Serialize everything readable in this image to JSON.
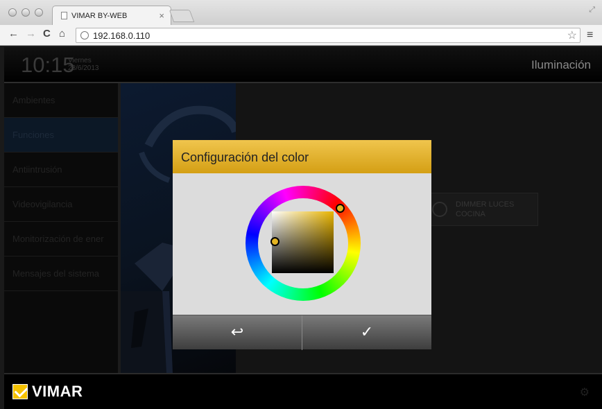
{
  "browser": {
    "tab_title": "VIMAR BY-WEB",
    "tab_close": "×",
    "url": "192.168.0.110",
    "back": "←",
    "forward": "→",
    "reload": "C",
    "home": "⌂",
    "star": "☆",
    "menu": "≡"
  },
  "header": {
    "time": "10:15",
    "day": "Viernes",
    "date": "28/6/2013",
    "section": "Iluminación"
  },
  "sidebar": {
    "items": [
      {
        "label": "Ambientes"
      },
      {
        "label": "Funciones"
      },
      {
        "label": "Antiintrusión"
      },
      {
        "label": "Videovigilancia"
      },
      {
        "label": "Monitorización de ener"
      },
      {
        "label": "Mensajes del sistema"
      }
    ],
    "active_index": 1
  },
  "content": {
    "dimmer_label": "DIMMER LUCES COCINA"
  },
  "footer": {
    "brand": "VIMAR"
  },
  "modal": {
    "title": "Configuración del color",
    "back_glyph": "↩",
    "confirm_glyph": "✓",
    "selected_color": "#e4b422",
    "accent": "#e0ae2a"
  }
}
